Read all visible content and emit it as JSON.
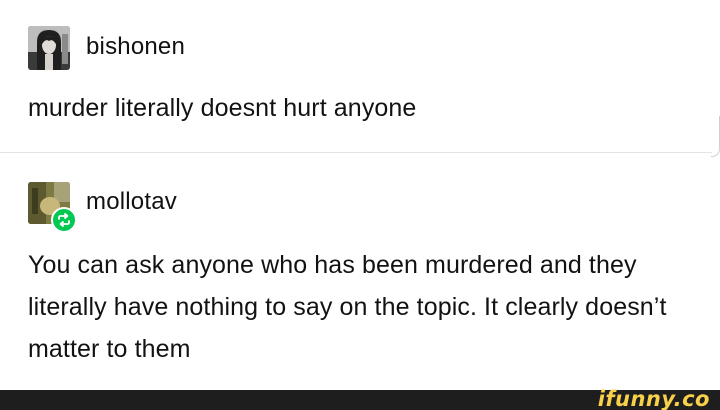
{
  "posts": [
    {
      "username": "bishonen",
      "text": "murder literally doesnt hurt anyone"
    },
    {
      "username": "mollotav",
      "text": "You can ask anyone who has been murdered and they literally have nothing to say on the topic. It clearly doesn’t matter to them",
      "badge_icon": "reblog-icon"
    }
  ],
  "colors": {
    "reblog_badge": "#00c853",
    "watermark_bar": "#1e1e1e",
    "watermark_text": "#f8d04a"
  },
  "watermark": {
    "text": "ifunny.co"
  }
}
